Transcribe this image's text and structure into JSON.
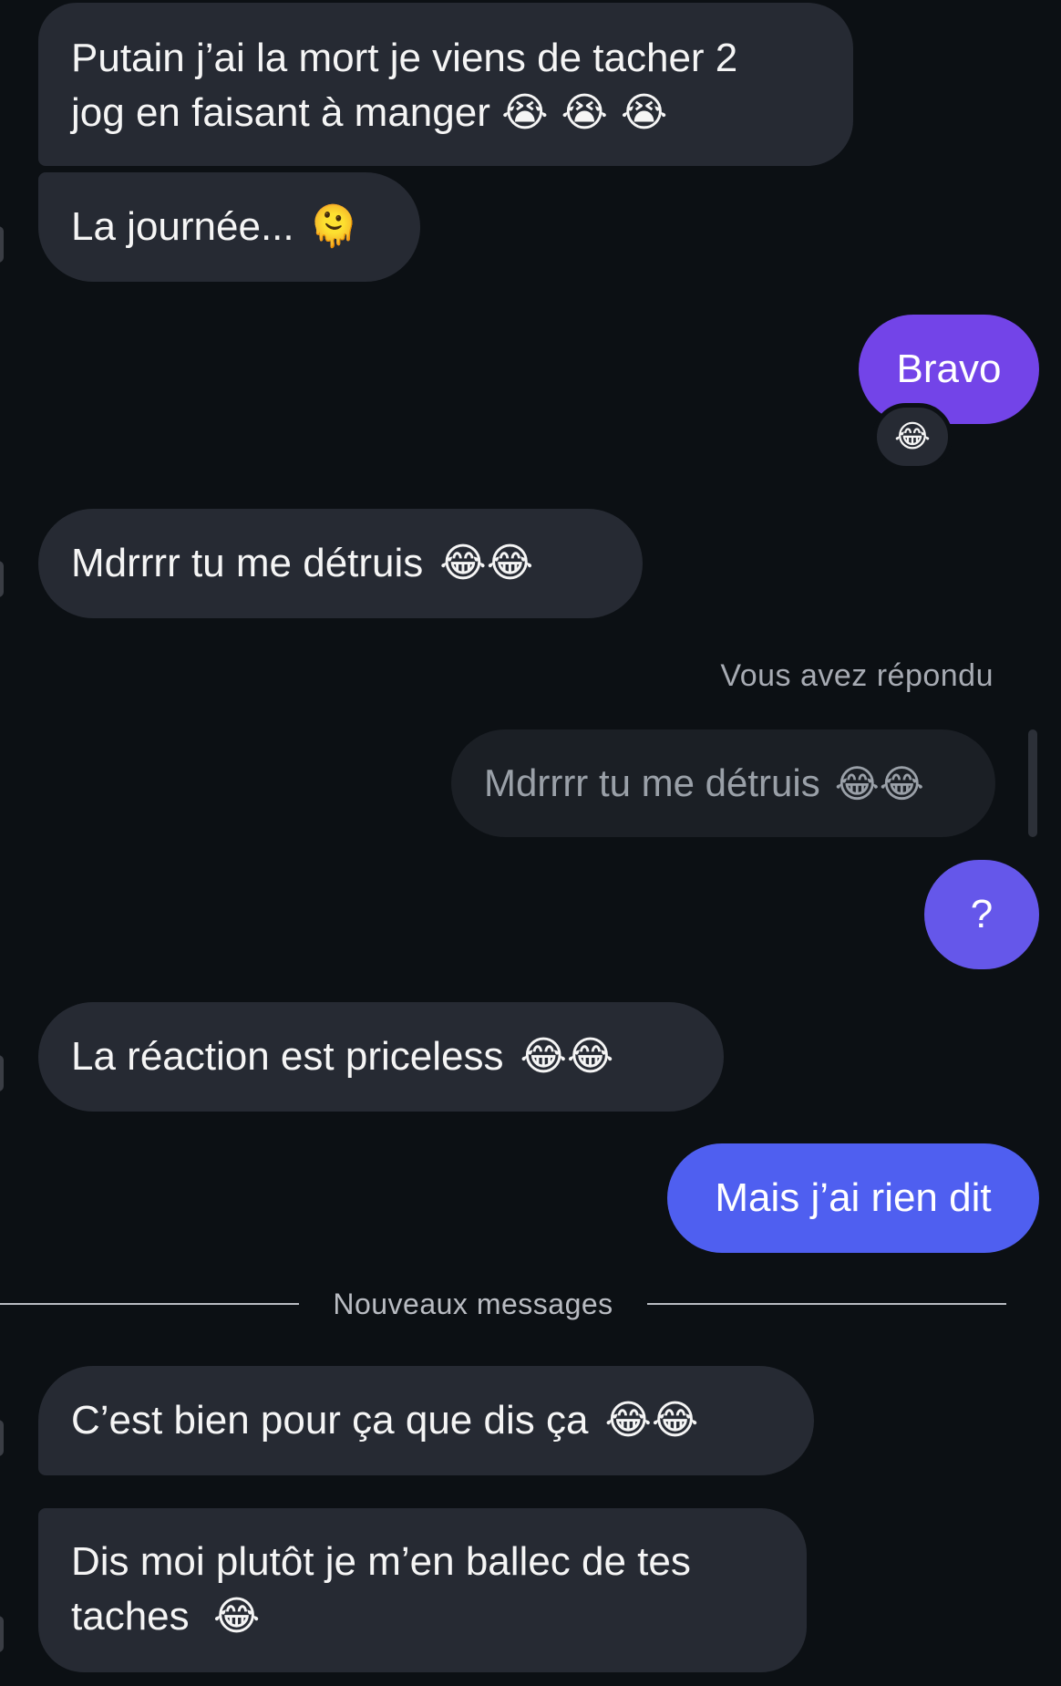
{
  "messages": {
    "m1": {
      "line1": "Putain j’ai la mort je viens de tacher 2",
      "line2": "jog en faisant à manger",
      "emoji": "😭 😭 😭"
    },
    "m2": {
      "text": "La journée...",
      "emoji": "🫠"
    },
    "m3": {
      "text": "Bravo",
      "reaction": "😂"
    },
    "m4": {
      "text": "Mdrrrr tu me détruis",
      "emoji": "😂😂"
    },
    "reply": {
      "label": "Vous avez répondu",
      "quote_text": "Mdrrrr tu me détruis",
      "quote_emoji": "😂😂"
    },
    "m5": {
      "text": "?"
    },
    "m6": {
      "text": "La réaction est priceless",
      "emoji": "😂😂"
    },
    "m7": {
      "text": "Mais j’ai rien dit"
    },
    "divider": {
      "label": "Nouveaux messages"
    },
    "m8": {
      "text": "C’est bien pour ça que dis ça",
      "emoji": "😂😂"
    },
    "m9": {
      "line1": "Dis moi plutôt je m’en ballec de tes",
      "line2": "taches",
      "emoji": "😂"
    }
  },
  "colors": {
    "background": "#0c1014",
    "incoming_bubble": "#262a33",
    "outgoing_purple": "#7344e8",
    "outgoing_violet": "#6557ea",
    "outgoing_blue": "#4f5ff0",
    "muted_text": "#a7abb3"
  }
}
